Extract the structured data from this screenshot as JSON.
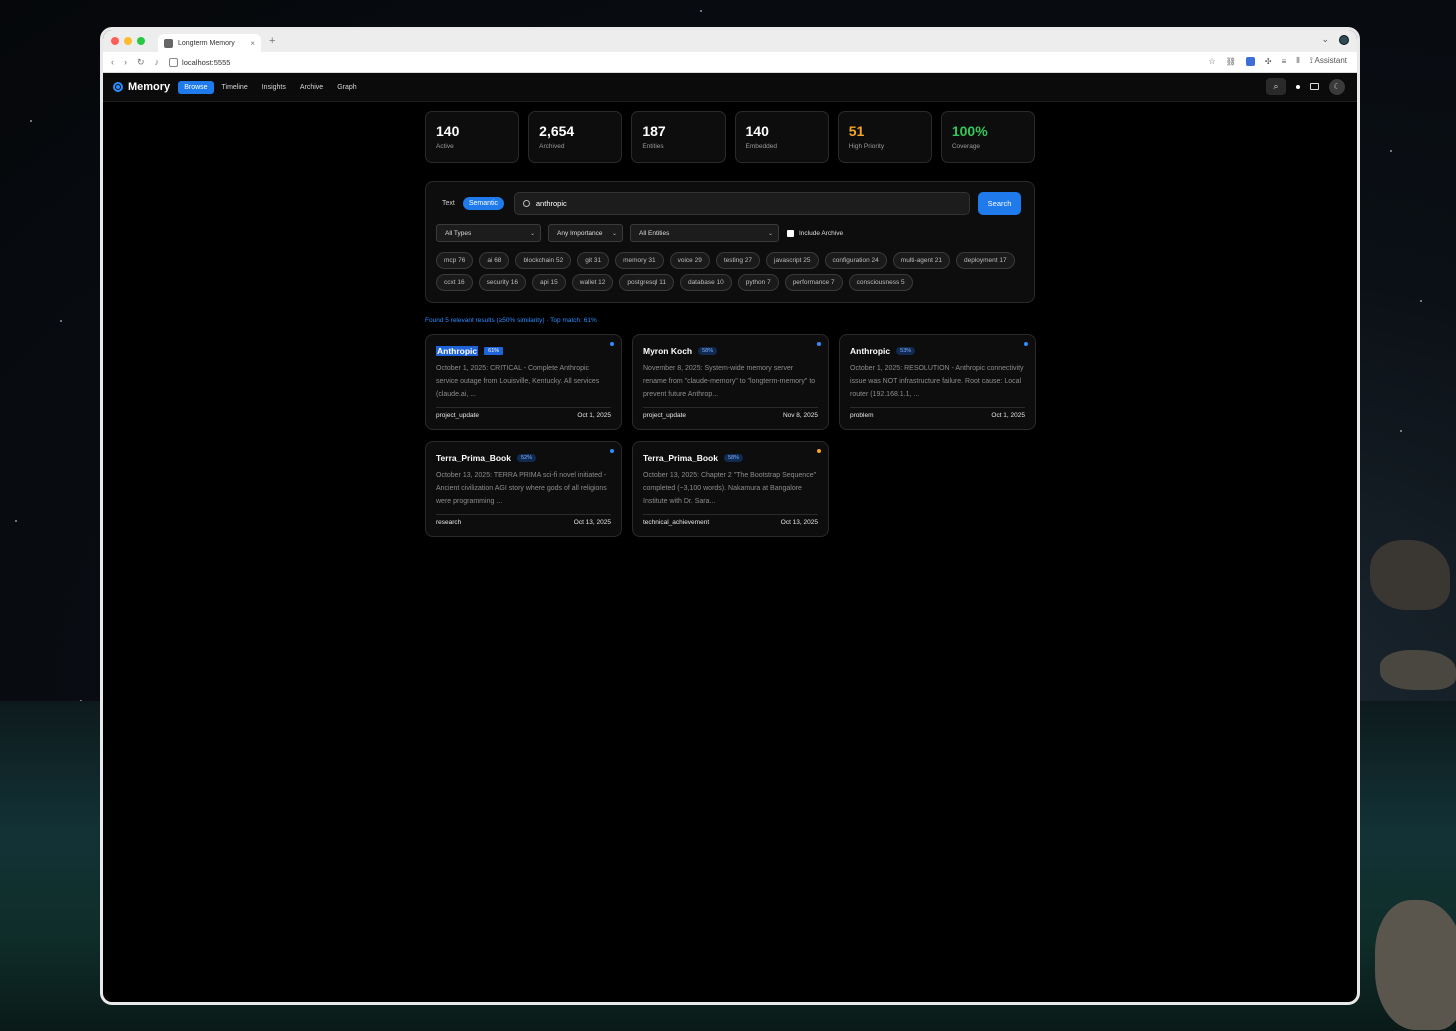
{
  "browser": {
    "tab_title": "Longterm Memory",
    "url": "localhost:5555",
    "assistant_label": "Assistant"
  },
  "app": {
    "name": "Memory",
    "nav": [
      {
        "label": "Browse",
        "active": true
      },
      {
        "label": "Timeline",
        "active": false
      },
      {
        "label": "Insights",
        "active": false
      },
      {
        "label": "Archive",
        "active": false
      },
      {
        "label": "Graph",
        "active": false
      }
    ]
  },
  "stats": [
    {
      "value": "140",
      "label": "Active",
      "color": "#ffffff"
    },
    {
      "value": "2,654",
      "label": "Archived",
      "color": "#ffffff"
    },
    {
      "value": "187",
      "label": "Entities",
      "color": "#ffffff"
    },
    {
      "value": "140",
      "label": "Embedded",
      "color": "#ffffff"
    },
    {
      "value": "51",
      "label": "High Priority",
      "color": "#f5a623"
    },
    {
      "value": "100%",
      "label": "Coverage",
      "color": "#34c759"
    }
  ],
  "search": {
    "modes": [
      {
        "label": "Text",
        "active": false
      },
      {
        "label": "Semantic",
        "active": true
      }
    ],
    "query": "anthropic",
    "button": "Search",
    "filters": {
      "types": "All Types",
      "importance": "Any Importance",
      "entities": "All Entities"
    },
    "include_archive": "Include Archive"
  },
  "tags": [
    "mcp 76",
    "ai 68",
    "blockchain 52",
    "git 31",
    "memory 31",
    "voice 29",
    "testing 27",
    "javascript 25",
    "configuration 24",
    "multi-agent 21",
    "deployment 17",
    "ccxt 16",
    "security 16",
    "api 15",
    "wallet 12",
    "postgresql 11",
    "database 10",
    "python 7",
    "performance 7",
    "consciousness 5"
  ],
  "results_info": "Found 5 relevant results (≥50% similarity) · Top match: 61%",
  "results": [
    {
      "title": "Anthropic",
      "similarity": "61%",
      "highlight": true,
      "dot_color": "#2d8cff",
      "text": "October 1, 2025: CRITICAL - Complete Anthropic service outage from Louisville, Kentucky. All services (claude.ai, ...",
      "type": "project_update",
      "date": "Oct 1, 2025"
    },
    {
      "title": "Myron Koch",
      "similarity": "58%",
      "highlight": false,
      "dot_color": "#2d8cff",
      "text": "November 8, 2025: System-wide memory server rename from \"claude-memory\" to \"longterm-memory\" to prevent future Anthrop...",
      "type": "project_update",
      "date": "Nov 8, 2025"
    },
    {
      "title": "Anthropic",
      "similarity": "53%",
      "highlight": false,
      "dot_color": "#2d8cff",
      "text": "October 1, 2025: RESOLUTION - Anthropic connectivity issue was NOT infrastructure failure. Root cause: Local router (192.168.1.1, ...",
      "type": "problem",
      "date": "Oct 1, 2025"
    },
    {
      "title": "Terra_Prima_Book",
      "similarity": "52%",
      "highlight": false,
      "dot_color": "#2d8cff",
      "text": "October 13, 2025: TERRA PRIMA sci-fi novel initiated - Ancient civilization AGI story where gods of all religions were programming ...",
      "type": "research",
      "date": "Oct 13, 2025"
    },
    {
      "title": "Terra_Prima_Book",
      "similarity": "58%",
      "highlight": false,
      "dot_color": "#f5a623",
      "text": "October 13, 2025: Chapter 2 \"The Bootstrap Sequence\" completed (~3,100 words). Nakamura at Bangalore Institute with Dr. Sara...",
      "type": "technical_achievement",
      "date": "Oct 13, 2025"
    }
  ]
}
